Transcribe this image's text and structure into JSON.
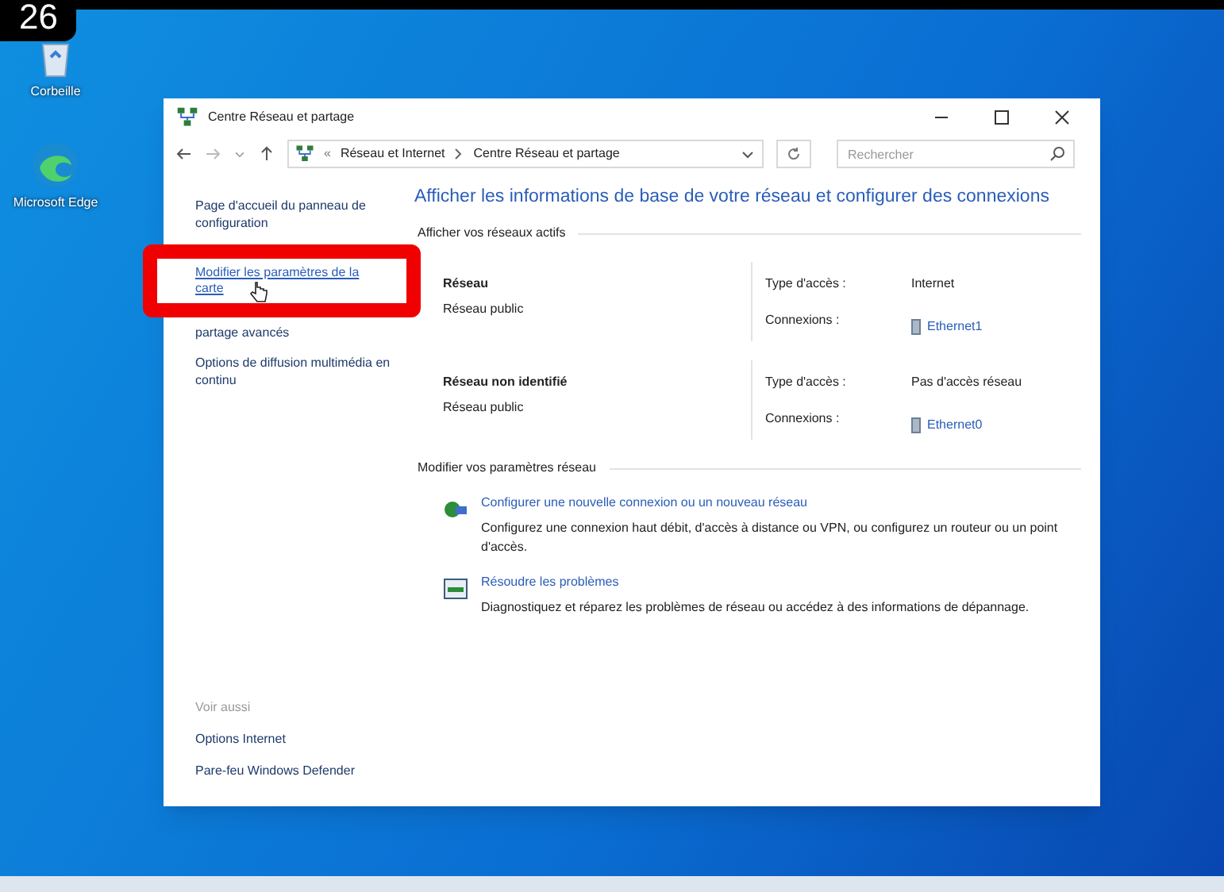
{
  "step_badge": "26",
  "desktop_icons": [
    {
      "label": "Corbeille",
      "kind": "bin"
    },
    {
      "label": "Microsoft Edge",
      "kind": "edge"
    }
  ],
  "window": {
    "title": "Centre Réseau et partage"
  },
  "address_bar": {
    "prefix": "«",
    "breadcrumb": [
      "Réseau et Internet",
      "Centre Réseau et partage"
    ]
  },
  "search": {
    "placeholder": "Rechercher"
  },
  "sidebar": {
    "items": [
      {
        "label": "Page d'accueil du panneau de configuration",
        "highlighted": false
      },
      {
        "label": "Modifier les paramètres de la carte",
        "highlighted": true
      },
      {
        "label": "partage avancés",
        "highlighted": false
      },
      {
        "label": "Options de diffusion multimédia en continu",
        "highlighted": false
      }
    ],
    "see_also": {
      "heading": "Voir aussi",
      "items": [
        "Options Internet",
        "Pare-feu Windows Defender"
      ]
    }
  },
  "main": {
    "heading": "Afficher les informations de base de votre réseau et configurer des connexions",
    "active_networks": {
      "title": "Afficher vos réseaux actifs",
      "networks": [
        {
          "name": "Réseau",
          "category": "Réseau public",
          "access_label": "Type d'accès :",
          "access": "Internet",
          "connections_label": "Connexions :",
          "connection": "Ethernet1"
        },
        {
          "name": "Réseau non identifié",
          "category": "Réseau public",
          "access_label": "Type d'accès :",
          "access": "Pas d'accès réseau",
          "connections_label": "Connexions :",
          "connection": "Ethernet0"
        }
      ]
    },
    "change_settings": {
      "title": "Modifier vos paramètres réseau",
      "tasks": [
        {
          "kind": "setup",
          "title": "Configurer une nouvelle connexion ou un nouveau réseau",
          "description": "Configurez une connexion haut débit, d'accès à distance ou VPN, ou configurez un routeur ou un point d'accès."
        },
        {
          "kind": "troubleshoot",
          "title": "Résoudre les problèmes",
          "description": "Diagnostiquez et réparez les problèmes de réseau ou accédez à des informations de dépannage."
        }
      ]
    }
  }
}
